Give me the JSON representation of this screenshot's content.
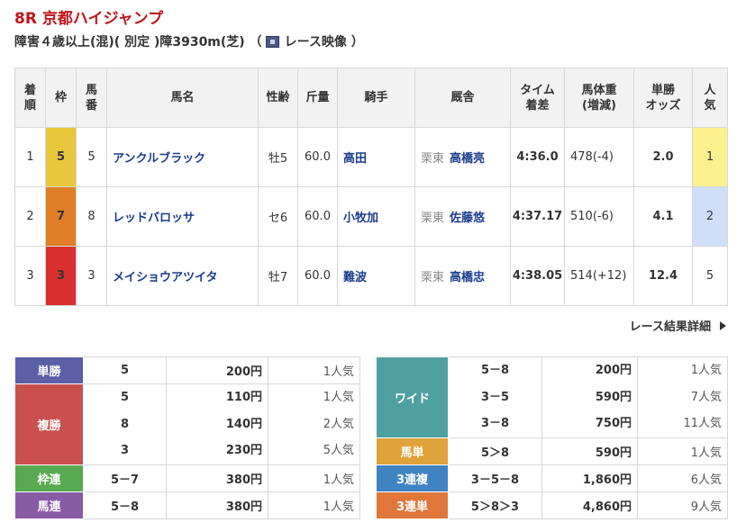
{
  "race": {
    "title": "8R 京都ハイジャンプ",
    "info": "障害４歳以上(混)( 別定 )障3930m(芝) （",
    "video_label": "レース映像 ）"
  },
  "table": {
    "headers": {
      "rank": "着順",
      "waku": "枠",
      "num": "馬番",
      "name": "馬名",
      "sex_age": "性齢",
      "weight": "斤量",
      "jockey": "騎手",
      "stable": "厩舎",
      "time": "タイム着差",
      "body": "馬体重(増減)",
      "odds": "単勝オッズ",
      "pop": "人気"
    },
    "rows": [
      {
        "rank": "1",
        "waku": "5",
        "waku_color": "#e8c83a",
        "num": "5",
        "name": "アンクルブラック",
        "sex_age": "牡5",
        "weight": "60.0",
        "jockey": "高田",
        "region": "栗東",
        "trainer": "高橋亮",
        "time": "4:36.0",
        "body": "478(-4)",
        "odds": "2.0",
        "pop": "1"
      },
      {
        "rank": "2",
        "waku": "7",
        "waku_color": "#e07d26",
        "num": "8",
        "name": "レッドバロッサ",
        "sex_age": "セ6",
        "weight": "60.0",
        "jockey": "小牧加",
        "region": "栗東",
        "trainer": "佐藤悠",
        "time": "4:37.17",
        "body": "510(-6)",
        "odds": "4.1",
        "pop": "2"
      },
      {
        "rank": "3",
        "waku": "3",
        "waku_color": "#d8312e",
        "num": "3",
        "name": "メイショウアツイタ",
        "sex_age": "牡7",
        "weight": "60.0",
        "jockey": "難波",
        "region": "栗東",
        "trainer": "高橋忠",
        "time": "4:38.05",
        "body": "514(+12)",
        "odds": "12.4",
        "pop": "5"
      }
    ]
  },
  "detail_link": "レース結果詳細",
  "payouts_left": {
    "tansho": {
      "label": "単勝",
      "color": "#5a5fa6",
      "combo": "5",
      "yen": "200円",
      "pop": "1人気"
    },
    "fukusho": {
      "label": "複勝",
      "color": "#c9504f",
      "combos": [
        "5",
        "8",
        "3"
      ],
      "yens": [
        "110円",
        "140円",
        "230円"
      ],
      "pops": [
        "1人気",
        "2人気",
        "5人気"
      ]
    },
    "wakuren": {
      "label": "枠連",
      "color": "#58a94f",
      "combo": "5－7",
      "yen": "380円",
      "pop": "1人気"
    },
    "umaren": {
      "label": "馬連",
      "color": "#8a5ba5",
      "combo": "5－8",
      "yen": "380円",
      "pop": "1人気"
    }
  },
  "payouts_right": {
    "wide": {
      "label": "ワイド",
      "color": "#4fa0a1",
      "combos": [
        "5－8",
        "3－5",
        "3－8"
      ],
      "yens": [
        "200円",
        "590円",
        "750円"
      ],
      "pops": [
        "1人気",
        "7人気",
        "11人気"
      ]
    },
    "umatan": {
      "label": "馬単",
      "color": "#e0a23a",
      "combo": "5＞8",
      "yen": "590円",
      "pop": "1人気"
    },
    "sanrenpuku": {
      "label": "3連複",
      "color": "#3f83c2",
      "combo": "3－5－8",
      "yen": "1,860円",
      "pop": "6人気"
    },
    "sanrentan": {
      "label": "3連単",
      "color": "#e0763a",
      "combo": "5＞8＞3",
      "yen": "4,860円",
      "pop": "9人気"
    }
  }
}
